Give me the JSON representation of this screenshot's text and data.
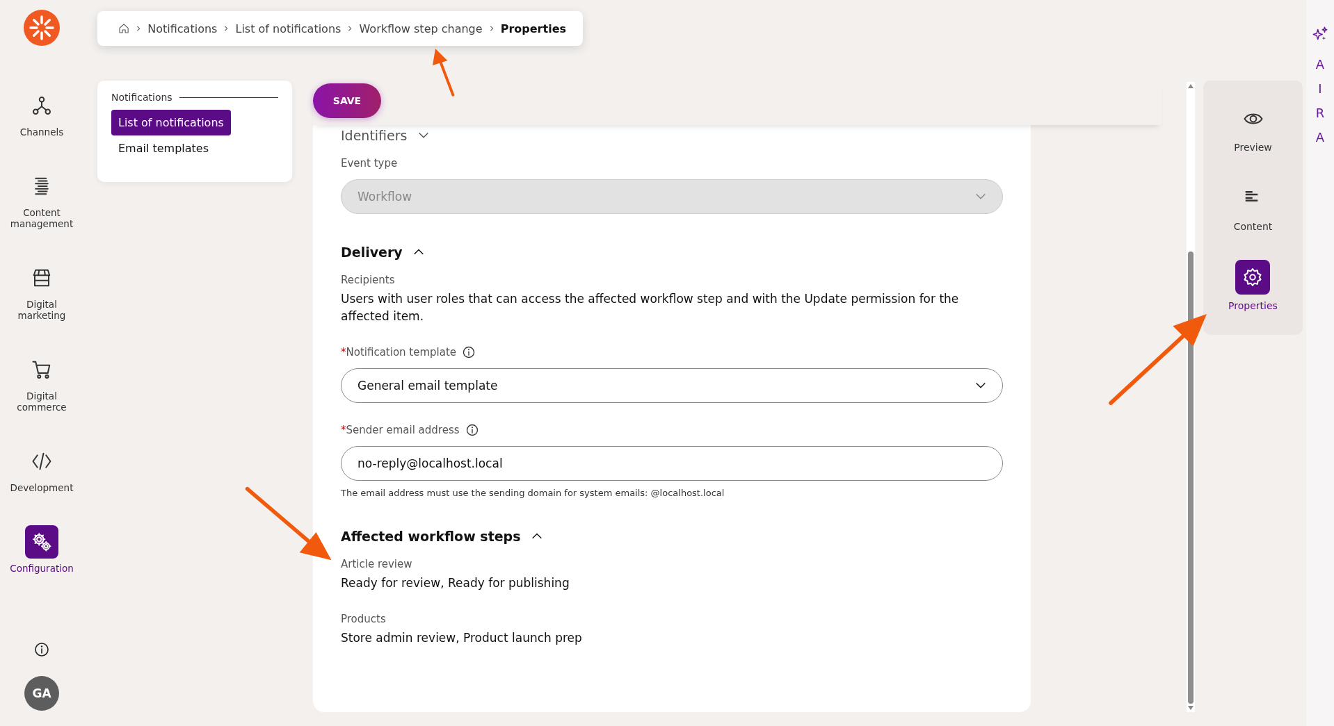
{
  "nav": {
    "items": [
      {
        "label": "Channels",
        "selected": false
      },
      {
        "label": "Content management",
        "selected": false
      },
      {
        "label": "Digital marketing",
        "selected": false
      },
      {
        "label": "Digital commerce",
        "selected": false
      },
      {
        "label": "Development",
        "selected": false
      },
      {
        "label": "Configuration",
        "selected": true
      }
    ],
    "user": {
      "initials": "GA"
    }
  },
  "breadcrumb": [
    "Notifications",
    "List of notifications",
    "Workflow step change",
    "Properties"
  ],
  "subnav": {
    "heading": "Notifications",
    "items": [
      {
        "label": "List of notifications",
        "selected": true
      },
      {
        "label": "Email templates",
        "selected": false
      }
    ]
  },
  "save_button": "SAVE",
  "form": [
    {
      "kind": "section",
      "title": "Identifiers",
      "expanded": false
    },
    {
      "kind": "select",
      "label": "Event type",
      "value": "Workflow",
      "disabled": true
    },
    {
      "kind": "section",
      "title": "Delivery",
      "expanded": true
    },
    {
      "kind": "text",
      "label": "Recipients",
      "value": "Users with user roles that can access the affected workflow step and with the Update permission for the affected item."
    },
    {
      "kind": "select",
      "label": "Notification template",
      "required_mark": "*",
      "info": true,
      "value": "General email template",
      "disabled": false
    },
    {
      "kind": "input",
      "label": "Sender email address",
      "required_mark": "*",
      "info": true,
      "value": "no-reply@localhost.local",
      "help": "The email address must use the sending domain for system emails: @localhost.local"
    },
    {
      "kind": "section",
      "title": "Affected workflow steps",
      "expanded": true
    },
    {
      "kind": "text",
      "label": "Article review",
      "value": "Ready for review, Ready for publishing"
    },
    {
      "kind": "text",
      "label": "Products",
      "value": "Store admin review, Product launch prep"
    }
  ],
  "side_panel": [
    {
      "label": "Preview",
      "selected": false
    },
    {
      "label": "Content",
      "selected": false
    },
    {
      "label": "Properties",
      "selected": true
    }
  ],
  "aira": [
    "A",
    "I",
    "R",
    "A"
  ]
}
